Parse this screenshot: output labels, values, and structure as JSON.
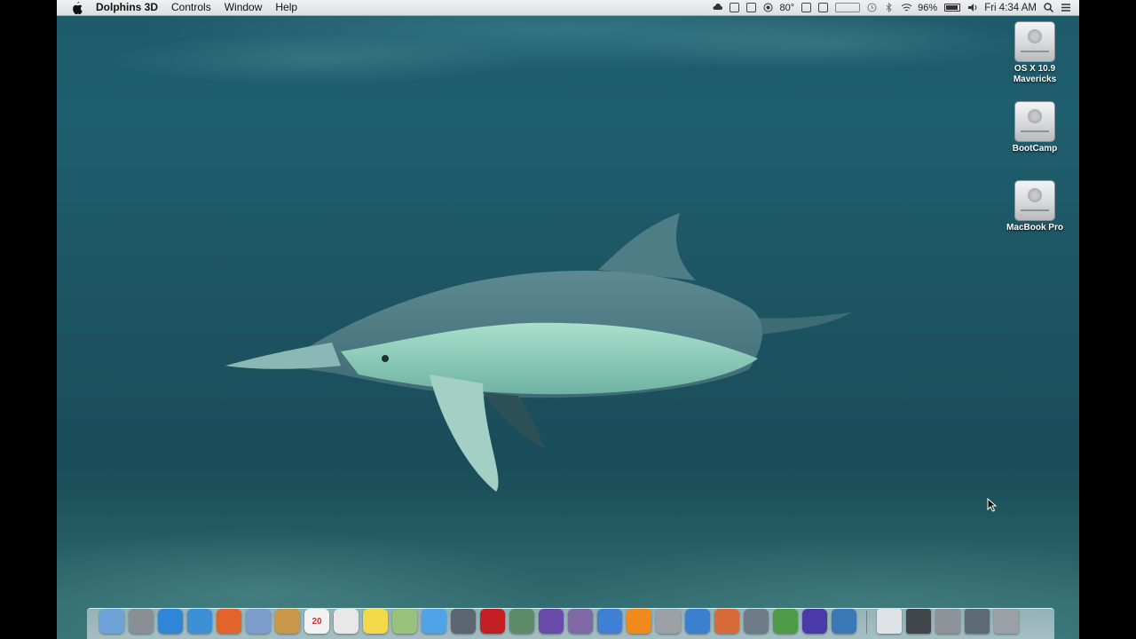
{
  "menubar": {
    "app_name": "Dolphins 3D",
    "menus": [
      "Controls",
      "Window",
      "Help"
    ],
    "temperature": "80°",
    "battery": "96%",
    "clock": "Fri 4:34 AM"
  },
  "desktop": {
    "drives": [
      {
        "label_line1": "OS X 10.9",
        "label_line2": "Mavericks"
      },
      {
        "label_line1": "BootCamp",
        "label_line2": ""
      },
      {
        "label_line1": "MacBook Pro",
        "label_line2": ""
      }
    ]
  },
  "dock": {
    "calendar_day": "20",
    "apps": [
      {
        "name": "finder-icon",
        "color": "#6fa3d8"
      },
      {
        "name": "launchpad-icon",
        "color": "#8a8f96"
      },
      {
        "name": "app-store-icon",
        "color": "#2f86d6"
      },
      {
        "name": "safari-icon",
        "color": "#3d8fd6"
      },
      {
        "name": "firefox-icon",
        "color": "#e3642a"
      },
      {
        "name": "preview-icon",
        "color": "#7c9ccc"
      },
      {
        "name": "contacts-icon",
        "color": "#c9974a"
      },
      {
        "name": "calendar-icon",
        "color": "#f2f2f2"
      },
      {
        "name": "textedit-icon",
        "color": "#e8e8e8"
      },
      {
        "name": "stickies-icon",
        "color": "#f3d94a"
      },
      {
        "name": "photos-icon",
        "color": "#9ac27a"
      },
      {
        "name": "messages-icon",
        "color": "#4fa3e6"
      },
      {
        "name": "facetime-icon",
        "color": "#5c6670"
      },
      {
        "name": "photo-booth-icon",
        "color": "#c21e24"
      },
      {
        "name": "image-capture-icon",
        "color": "#5d8a68"
      },
      {
        "name": "imovie-icon",
        "color": "#6a4aa8"
      },
      {
        "name": "star-app-icon",
        "color": "#7f6aa6"
      },
      {
        "name": "itunes-icon",
        "color": "#3f7fd4"
      },
      {
        "name": "ibooks-icon",
        "color": "#f08a1d"
      },
      {
        "name": "system-preferences-icon",
        "color": "#9ba1a6"
      },
      {
        "name": "migration-icon",
        "color": "#3b7fcf"
      },
      {
        "name": "keynote-icon",
        "color": "#d86a3a"
      },
      {
        "name": "script-editor-icon",
        "color": "#6f7b86"
      },
      {
        "name": "numbers-icon",
        "color": "#4d9a48"
      },
      {
        "name": "dolphins-3d-icon",
        "color": "#4a3aa8"
      },
      {
        "name": "quicktime-icon",
        "color": "#3a78b8"
      }
    ],
    "stacks": [
      {
        "name": "documents-stack-icon",
        "color": "#dfe3e8"
      },
      {
        "name": "downloads-stack-icon",
        "color": "#41464c"
      },
      {
        "name": "applications-stack-icon",
        "color": "#8d9399"
      },
      {
        "name": "desktop-stack-icon",
        "color": "#5d6a73"
      },
      {
        "name": "trash-icon",
        "color": "#9aa0a5"
      }
    ]
  }
}
